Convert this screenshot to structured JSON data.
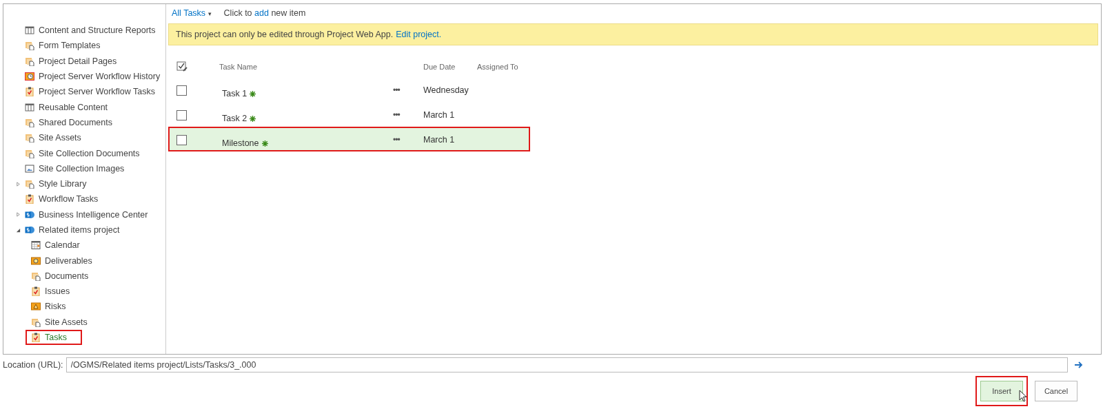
{
  "tree": [
    {
      "label": "Content and Structure Reports",
      "kind": "table",
      "selected": false
    },
    {
      "label": "Form Templates",
      "kind": "folder",
      "selected": false
    },
    {
      "label": "Project Detail Pages",
      "kind": "folder",
      "selected": false
    },
    {
      "label": "Project Server Workflow History",
      "kind": "history",
      "selected": false
    },
    {
      "label": "Project Server Workflow Tasks",
      "kind": "tasks",
      "selected": false
    },
    {
      "label": "Reusable Content",
      "kind": "table",
      "selected": false
    },
    {
      "label": "Shared Documents",
      "kind": "folder",
      "selected": false
    },
    {
      "label": "Site Assets",
      "kind": "folder",
      "selected": false
    },
    {
      "label": "Site Collection Documents",
      "kind": "folder",
      "selected": false
    },
    {
      "label": "Site Collection Images",
      "kind": "image",
      "selected": false
    },
    {
      "label": "Style Library",
      "kind": "folder",
      "selected": false,
      "expanded": false
    },
    {
      "label": "Workflow Tasks",
      "kind": "tasks",
      "selected": false
    },
    {
      "label": "Business Intelligence Center",
      "kind": "site",
      "selected": false,
      "expanded": false
    },
    {
      "label": "Related items project",
      "kind": "site",
      "selected": false,
      "expanded": true,
      "children": [
        {
          "label": "Calendar",
          "kind": "calendar",
          "selected": false
        },
        {
          "label": "Deliverables",
          "kind": "deliverables",
          "selected": false
        },
        {
          "label": "Documents",
          "kind": "folder",
          "selected": false
        },
        {
          "label": "Issues",
          "kind": "tasks",
          "selected": false
        },
        {
          "label": "Risks",
          "kind": "risks",
          "selected": false
        },
        {
          "label": "Site Assets",
          "kind": "folder",
          "selected": false
        },
        {
          "label": "Tasks",
          "kind": "tasks",
          "selected": true
        }
      ]
    }
  ],
  "toolbar": {
    "view": "All Tasks",
    "caret": "▾",
    "prefix": "Click to",
    "link": "add",
    "suffix": "new item"
  },
  "banner": {
    "text": "This project can only be edited through Project Web App.",
    "link": "Edit project."
  },
  "table": {
    "columns": [
      "Task Name",
      "Due Date",
      "Assigned To"
    ],
    "rows": [
      {
        "name": "Task 1",
        "new": true,
        "menu": "•••",
        "due": "Wednesday",
        "checked": false,
        "selected": false
      },
      {
        "name": "Task 2",
        "new": true,
        "menu": "•••",
        "due": "March 1",
        "checked": false,
        "selected": false
      },
      {
        "name": "Milestone",
        "new": true,
        "menu": "•••",
        "due": "March 1",
        "checked": false,
        "selected": true
      }
    ]
  },
  "location": {
    "label": "Location (URL):",
    "value": "/OGMS/Related items project/Lists/Tasks/3_.000"
  },
  "buttons": [
    {
      "label": "Insert",
      "highlighted": true
    },
    {
      "label": "Cancel",
      "highlighted": false
    }
  ]
}
